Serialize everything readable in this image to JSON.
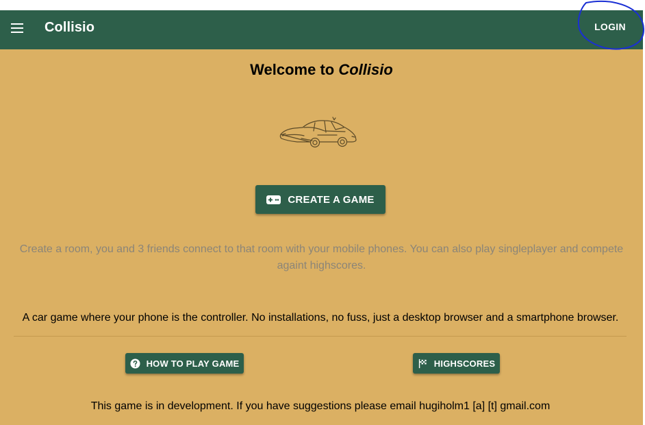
{
  "appbar": {
    "title": "Collisio",
    "login_label": "LOGIN",
    "menu_icon": "menu-icon"
  },
  "main": {
    "welcome_prefix": "Welcome to",
    "welcome_brand": "Collisio",
    "create_button_label": "CREATE A GAME",
    "create_button_icon": "gamepad-icon",
    "subtitle": "Create a room, you and 3 friends connect to that room with your mobile phones. You can also play singleplayer and compete againt highscores.",
    "tagline": "A car game where your phone is the controller. No installations, no fuss, just a desktop browser and a smartphone browser.",
    "how_to_play_label": "HOW TO PLAY GAME",
    "how_to_play_icon": "help-circle-icon",
    "highscores_label": "HIGHSCORES",
    "highscores_icon": "checkered-flag-icon",
    "footer": "This game is in development. If you have suggestions please email hugiholm1 [a] [t] gmail.com"
  },
  "colors": {
    "appbar": "#2d5f4a",
    "background": "#dbb063",
    "button": "#2d5f4a",
    "subtitle_text": "#8b8578",
    "annotation": "#1a2fd4"
  }
}
